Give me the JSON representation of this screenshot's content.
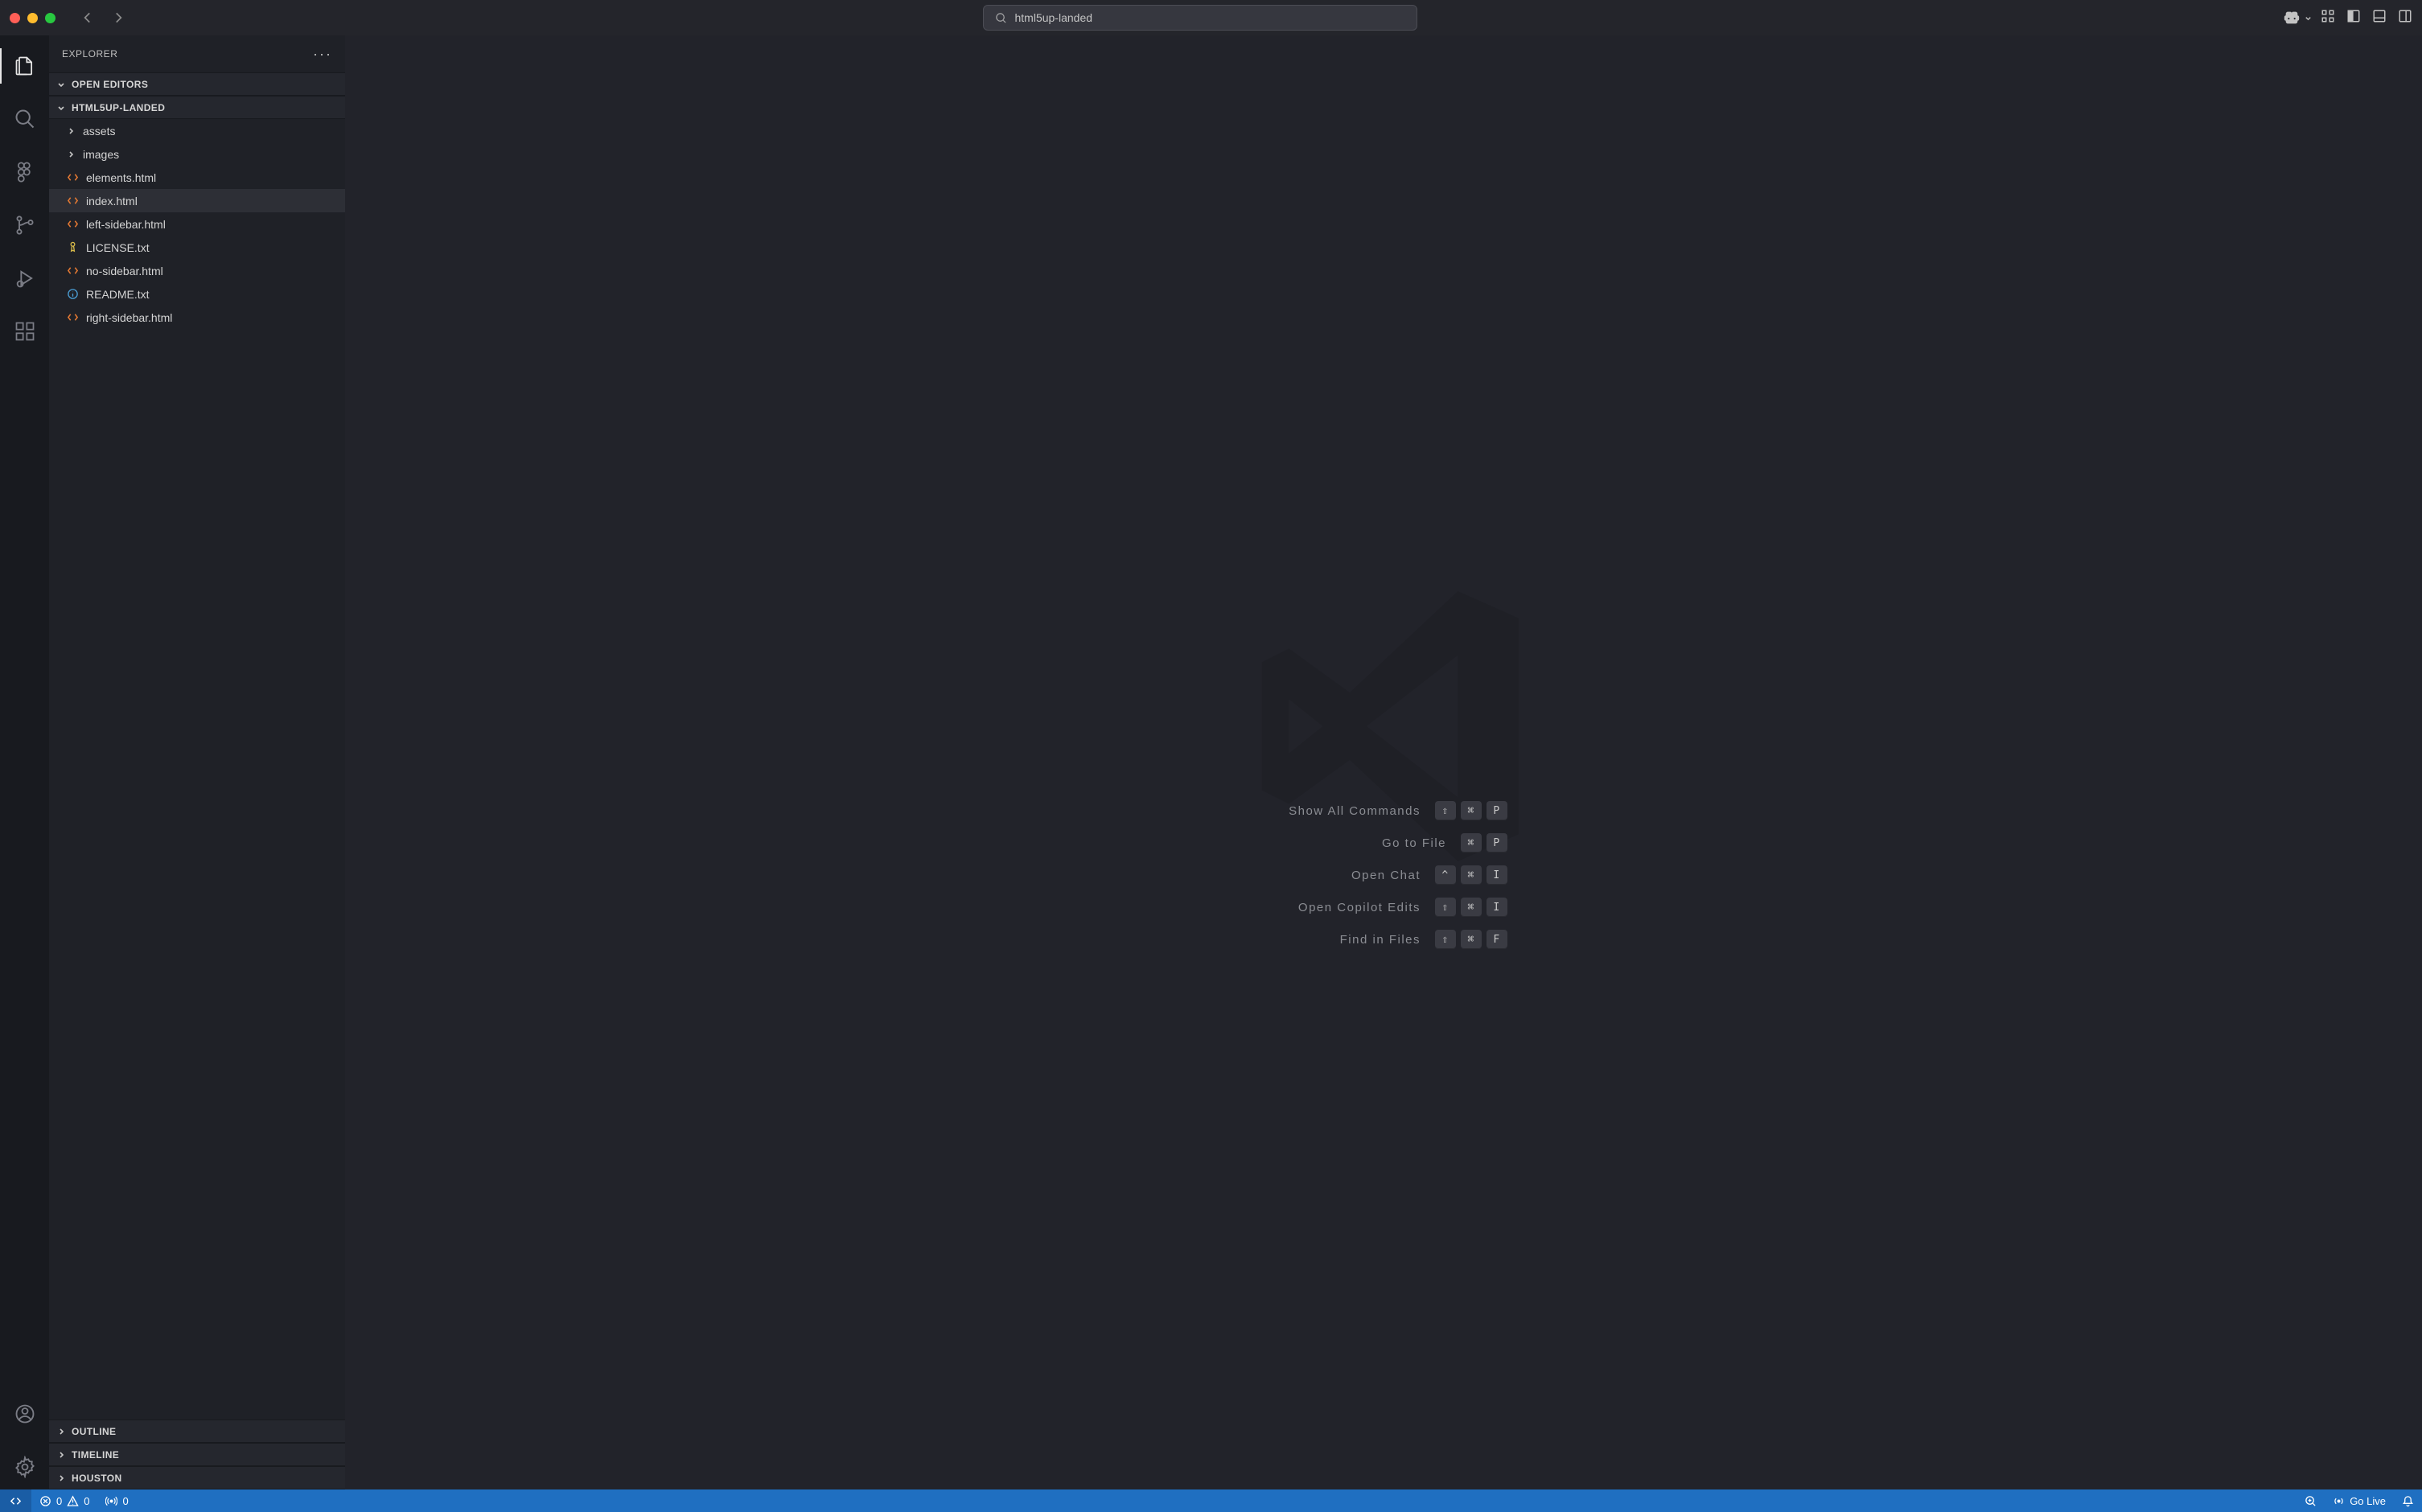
{
  "titlebar": {
    "search_text": "html5up-landed"
  },
  "sidebar": {
    "title": "EXPLORER",
    "sections": {
      "open_editors": "OPEN EDITORS",
      "project": "HTML5UP-LANDED",
      "outline": "OUTLINE",
      "timeline": "TIMELINE",
      "houston": "HOUSTON"
    },
    "tree": {
      "folders": [
        {
          "name": "assets"
        },
        {
          "name": "images"
        }
      ],
      "files": [
        {
          "name": "elements.html",
          "icon": "html"
        },
        {
          "name": "index.html",
          "icon": "html",
          "selected": true
        },
        {
          "name": "left-sidebar.html",
          "icon": "html"
        },
        {
          "name": "LICENSE.txt",
          "icon": "key"
        },
        {
          "name": "no-sidebar.html",
          "icon": "html"
        },
        {
          "name": "README.txt",
          "icon": "info"
        },
        {
          "name": "right-sidebar.html",
          "icon": "html"
        }
      ]
    }
  },
  "welcome": {
    "shortcuts": [
      {
        "label": "Show All Commands",
        "keys": [
          "⇧",
          "⌘",
          "P"
        ]
      },
      {
        "label": "Go to File",
        "keys": [
          "⌘",
          "P"
        ]
      },
      {
        "label": "Open Chat",
        "keys": [
          "^",
          "⌘",
          "I"
        ]
      },
      {
        "label": "Open Copilot Edits",
        "keys": [
          "⇧",
          "⌘",
          "I"
        ]
      },
      {
        "label": "Find in Files",
        "keys": [
          "⇧",
          "⌘",
          "F"
        ]
      }
    ]
  },
  "statusbar": {
    "errors": "0",
    "warnings": "0",
    "ports": "0",
    "golive": "Go Live"
  }
}
